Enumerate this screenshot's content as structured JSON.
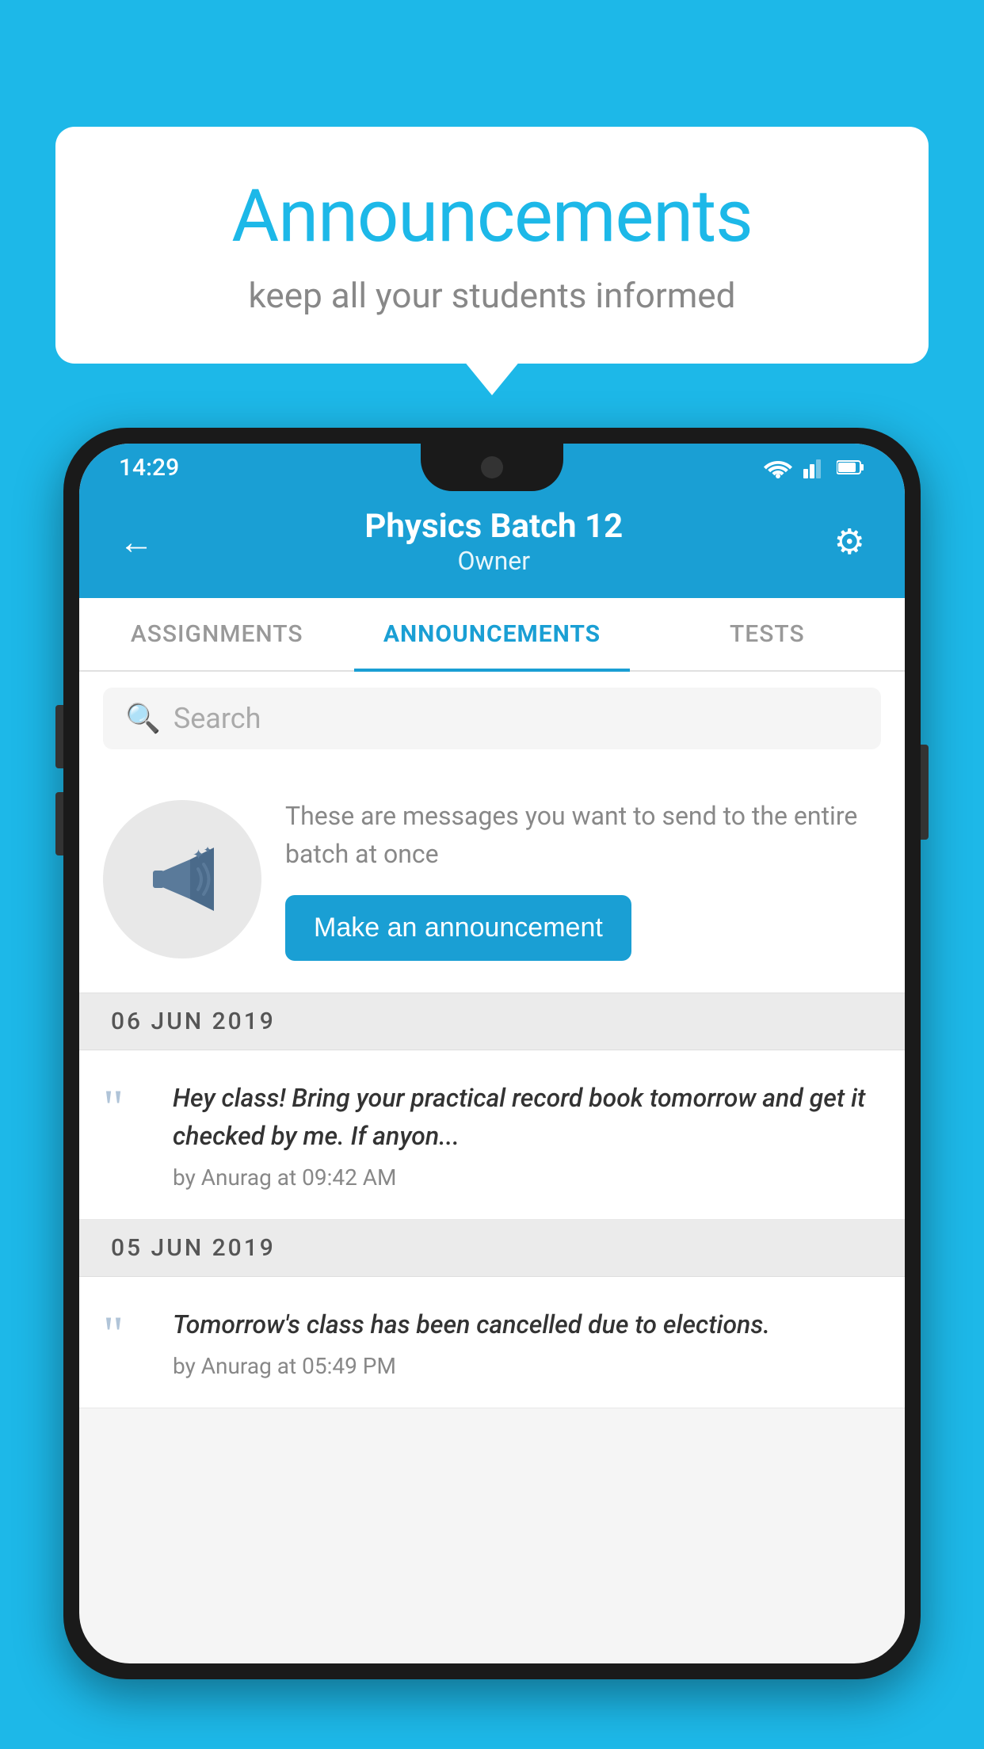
{
  "background_color": "#1db8e8",
  "bubble": {
    "title": "Announcements",
    "subtitle": "keep all your students informed"
  },
  "phone": {
    "status_bar": {
      "time": "14:29"
    },
    "header": {
      "title": "Physics Batch 12",
      "subtitle": "Owner",
      "back_label": "←",
      "settings_label": "⚙"
    },
    "tabs": [
      {
        "label": "ASSIGNMENTS",
        "active": false
      },
      {
        "label": "ANNOUNCEMENTS",
        "active": true
      },
      {
        "label": "TESTS",
        "active": false
      }
    ],
    "search": {
      "placeholder": "Search"
    },
    "promo": {
      "description": "These are messages you want to send to the entire batch at once",
      "button_label": "Make an announcement"
    },
    "date_groups": [
      {
        "date": "06  JUN  2019",
        "announcements": [
          {
            "text": "Hey class! Bring your practical record book tomorrow and get it checked by me. If anyon...",
            "meta": "by Anurag at 09:42 AM"
          }
        ]
      },
      {
        "date": "05  JUN  2019",
        "announcements": [
          {
            "text": "Tomorrow's class has been cancelled due to elections.",
            "meta": "by Anurag at 05:49 PM"
          }
        ]
      }
    ]
  }
}
